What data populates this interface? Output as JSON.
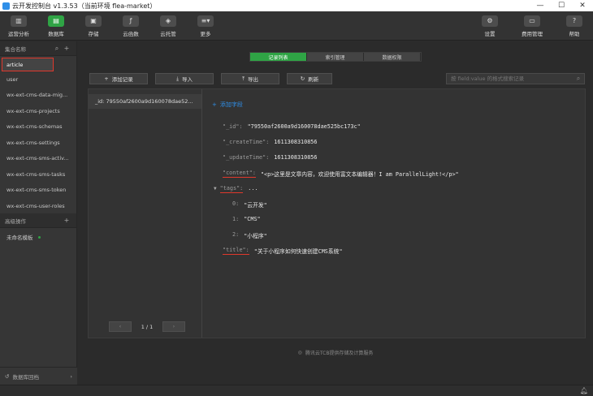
{
  "window": {
    "title": "云开发控制台 v1.3.53（当前环境 flea-market）"
  },
  "toolbar": {
    "left": [
      "运营分析",
      "数据库",
      "存储",
      "云函数",
      "云托管",
      "更多"
    ],
    "right": [
      "设置",
      "费用管理",
      "帮助"
    ],
    "active": "数据库"
  },
  "sidebar": {
    "collections_header": "集合名称",
    "collections": [
      "article",
      "user",
      "wx-ext-cms-data-mig...",
      "wx-ext-cms-projects",
      "wx-ext-cms-schemas",
      "wx-ext-cms-settings",
      "wx-ext-cms-sms-activ...",
      "wx-ext-cms-sms-tasks",
      "wx-ext-cms-sms-token",
      "wx-ext-cms-user-roles"
    ],
    "selected": "article",
    "advanced_header": "高级操作",
    "template_name": "未命名模板",
    "rollback": "数据库回档"
  },
  "tabs": [
    "记录列表",
    "索引管理",
    "数据权限"
  ],
  "active_tab": "记录列表",
  "actions": {
    "add": "添加记录",
    "import": "导入",
    "export": "导出",
    "refresh": "刷新"
  },
  "search": {
    "placeholder": "按 field:value 的格式搜索记录"
  },
  "records": [
    "_id: 79550af2600a9d160078dae52..."
  ],
  "pager": {
    "page": "1 / 1"
  },
  "detail": {
    "add_field": "添加字段",
    "id_key": "\"_id\":",
    "id_val": "\"79550af2600a9d160078dae525bc173c\"",
    "create_key": "\"_createTime\":",
    "create_val": "1611308310856",
    "update_key": "\"_updateTime\":",
    "update_val": "1611308310856",
    "content_key": "\"content\":",
    "content_val": "\"<p>这里是文章内容，欢迎使用富文本编辑器！I am ParallelLight!</p>\"",
    "tags_key": "\"tags\":",
    "tags_ellipsis": "...",
    "tag0_key": "0:",
    "tag0_val": "\"云开发\"",
    "tag1_key": "1:",
    "tag1_val": "\"CMS\"",
    "tag2_key": "2:",
    "tag2_val": "\"小程序\"",
    "title_key": "\"title\":",
    "title_val": "\"关于小程序如何快速创建CMS系统\""
  },
  "footer": "腾讯云TCB提供存储及计算服务",
  "colors": {
    "accent_green": "#2fa445",
    "link_blue": "#2f8fe8",
    "annotation_red": "#e0382c"
  }
}
